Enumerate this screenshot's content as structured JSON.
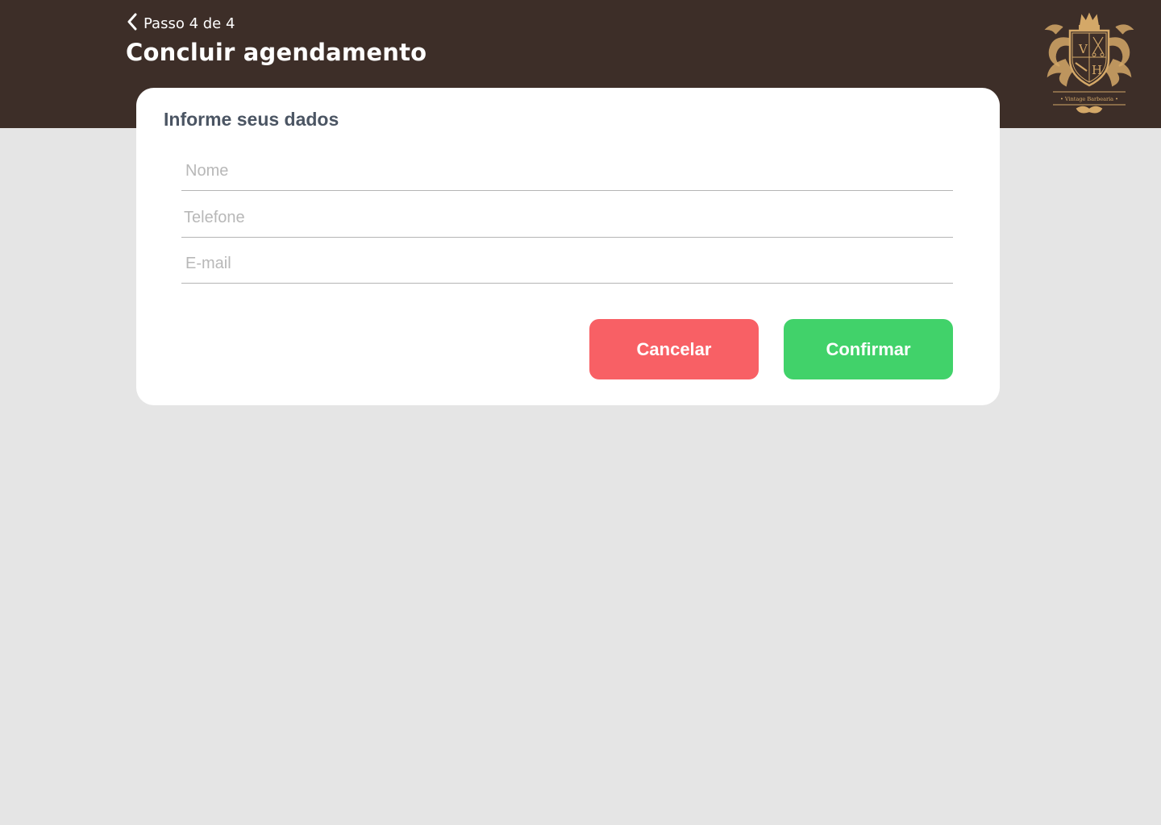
{
  "header": {
    "step_label": "Passo 4 de 4",
    "title": "Concluir agendamento",
    "back_icon": "chevron-left-icon",
    "logo": {
      "monogram_top": "V",
      "monogram_bottom": "H",
      "brand_text": "• Vintage Barbearia •",
      "color": "#d4a868"
    },
    "background_color": "#3d2e28"
  },
  "form": {
    "title": "Informe seus dados",
    "fields": {
      "nome": {
        "placeholder": "Nome",
        "value": ""
      },
      "telefone": {
        "placeholder": "Telefone",
        "value": ""
      },
      "email": {
        "placeholder": "E-mail",
        "value": ""
      }
    },
    "buttons": {
      "cancel": {
        "label": "Cancelar",
        "color": "#f86065"
      },
      "confirm": {
        "label": "Confirmar",
        "color": "#41d26a"
      }
    }
  }
}
